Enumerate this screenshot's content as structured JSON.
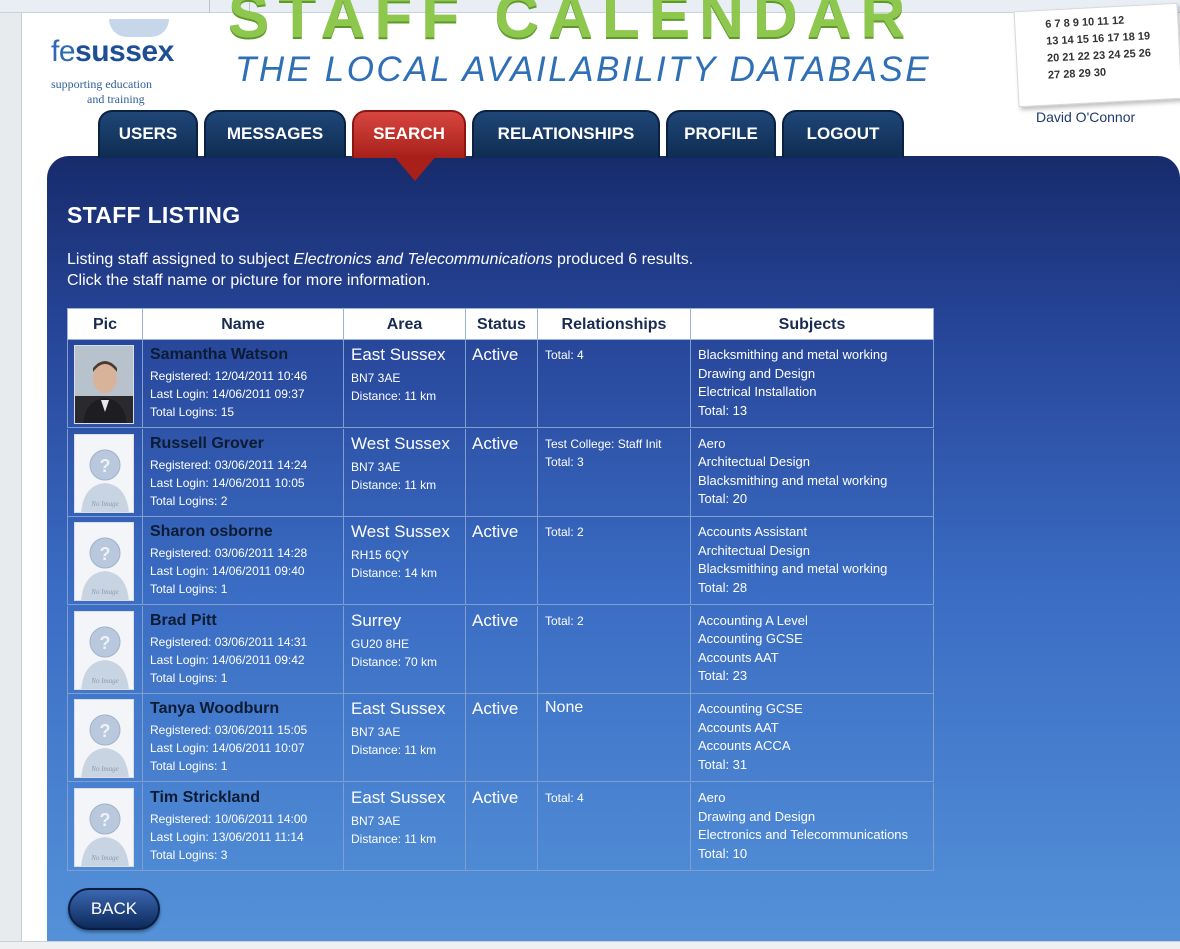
{
  "header": {
    "logo": {
      "name_light": "fe",
      "name_bold": "sussex",
      "tagline_1": "supporting education",
      "tagline_2": "and training"
    },
    "big_title": "STAFF CALENDAR",
    "subtitle": "THE LOCAL AVAILABILITY DATABASE",
    "calendar_rows": [
      "6 7 8 9 10 11 12",
      "13 14 15 16 17 18 19",
      "20 21 22 23 24 25 26",
      "27 28 29 30"
    ],
    "user_name": "David O'Connor"
  },
  "nav": {
    "tabs": [
      {
        "label": "USERS",
        "active": false
      },
      {
        "label": "MESSAGES",
        "active": false
      },
      {
        "label": "SEARCH",
        "active": true
      },
      {
        "label": "RELATIONSHIPS",
        "active": false
      },
      {
        "label": "PROFILE",
        "active": false
      },
      {
        "label": "LOGOUT",
        "active": false
      }
    ]
  },
  "page": {
    "title": "STAFF LISTING",
    "intro_prefix": "Listing staff assigned to subject ",
    "intro_subject": "Electronics and Telecommunications",
    "intro_suffix": " produced 6 results.",
    "intro_line2": "Click the staff name or picture for more information."
  },
  "table": {
    "headers": [
      "Pic",
      "Name",
      "Area",
      "Status",
      "Relationships",
      "Subjects"
    ],
    "rows": [
      {
        "pic": "photo",
        "name": "Samantha Watson",
        "registered": "Registered: 12/04/2011 10:46",
        "last_login": "Last Login: 14/06/2011 09:37",
        "total_logins": "Total Logins: 15",
        "area": "East Sussex",
        "postcode": "BN7 3AE",
        "distance": "Distance: 11 km",
        "status": "Active",
        "relationships": [
          "Total: 4"
        ],
        "subjects": [
          "Blacksmithing and metal working",
          "Drawing and Design",
          "Electrical Installation",
          "Total: 13"
        ]
      },
      {
        "pic": "no-image",
        "name": "Russell Grover",
        "registered": "Registered: 03/06/2011 14:24",
        "last_login": "Last Login: 14/06/2011 10:05",
        "total_logins": "Total Logins: 2",
        "area": "West Sussex",
        "postcode": "BN7 3AE",
        "distance": "Distance: 11 km",
        "status": "Active",
        "relationships": [
          "Test College: Staff Init",
          "Total: 3"
        ],
        "subjects": [
          "Aero",
          "Architectual Design",
          "Blacksmithing and metal working",
          "Total: 20"
        ]
      },
      {
        "pic": "no-image",
        "name": "Sharon osborne",
        "registered": "Registered: 03/06/2011 14:28",
        "last_login": "Last Login: 14/06/2011 09:40",
        "total_logins": "Total Logins: 1",
        "area": "West Sussex",
        "postcode": "RH15 6QY",
        "distance": "Distance: 14 km",
        "status": "Active",
        "relationships": [
          "Total: 2"
        ],
        "subjects": [
          "Accounts Assistant",
          "Architectual Design",
          "Blacksmithing and metal working",
          "Total: 28"
        ]
      },
      {
        "pic": "no-image",
        "name": "Brad Pitt",
        "registered": "Registered: 03/06/2011 14:31",
        "last_login": "Last Login: 14/06/2011 09:42",
        "total_logins": "Total Logins: 1",
        "area": "Surrey",
        "postcode": "GU20 8HE",
        "distance": "Distance: 70 km",
        "status": "Active",
        "relationships": [
          "Total: 2"
        ],
        "subjects": [
          "Accounting A Level",
          "Accounting GCSE",
          "Accounts AAT",
          "Total: 23"
        ]
      },
      {
        "pic": "no-image",
        "name": "Tanya Woodburn",
        "registered": "Registered: 03/06/2011 15:05",
        "last_login": "Last Login: 14/06/2011 10:07",
        "total_logins": "Total Logins: 1",
        "area": "East Sussex",
        "postcode": "BN7 3AE",
        "distance": "Distance: 11 km",
        "status": "Active",
        "relationships": [
          "None"
        ],
        "subjects": [
          "Accounting GCSE",
          "Accounts AAT",
          "Accounts ACCA",
          "Total: 31"
        ]
      },
      {
        "pic": "no-image",
        "name": "Tim Strickland",
        "registered": "Registered: 10/06/2011 14:00",
        "last_login": "Last Login: 13/06/2011 11:14",
        "total_logins": "Total Logins: 3",
        "area": "East Sussex",
        "postcode": "BN7 3AE",
        "distance": "Distance: 11 km",
        "status": "Active",
        "relationships": [
          "Total: 4"
        ],
        "subjects": [
          "Aero",
          "Drawing and Design",
          "Electronics and Telecommunications",
          "Total: 10"
        ]
      }
    ],
    "no_image_label": "No Image"
  },
  "footer": {
    "back_label": "BACK"
  },
  "colors": {
    "nav_tab": "#163a66",
    "nav_active": "#c0332d",
    "panel_top": "#172b6b",
    "panel_bottom": "#5593da",
    "title_green": "#8ec74d",
    "subtitle_blue": "#2f6fb6"
  }
}
